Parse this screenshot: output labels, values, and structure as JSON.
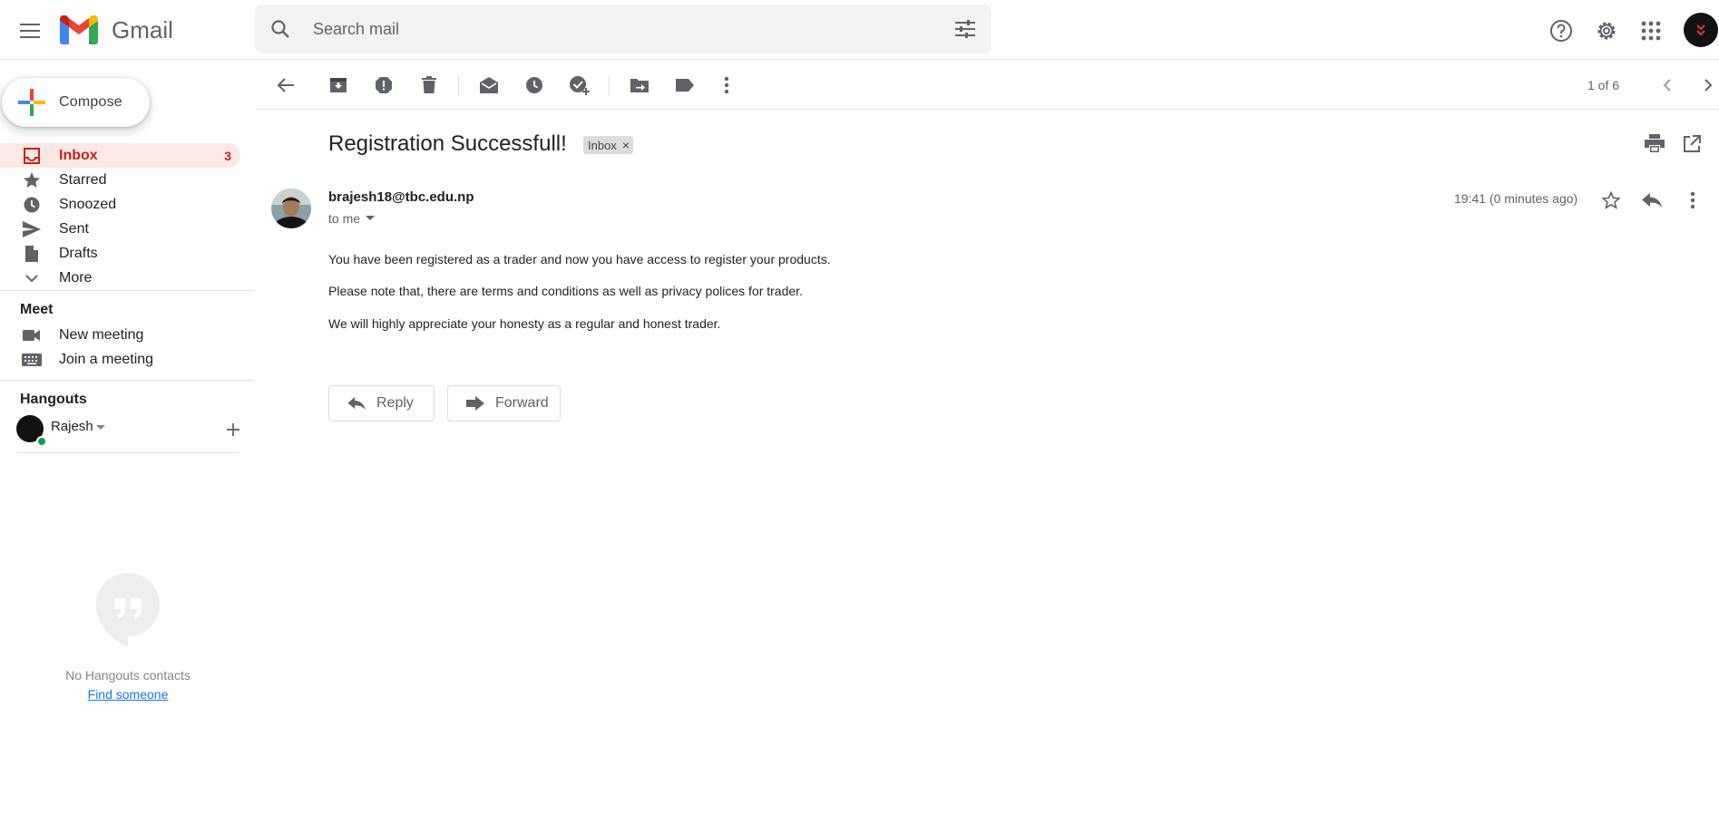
{
  "header": {
    "app_name": "Gmail",
    "search_placeholder": "Search mail",
    "icons": [
      "main-menu-icon",
      "gmail-logo",
      "search-icon",
      "search-options-icon",
      "help-icon",
      "settings-icon",
      "apps-icon",
      "account-avatar"
    ]
  },
  "sidebar": {
    "compose_label": "Compose",
    "items": [
      {
        "label": "Inbox",
        "count": "3",
        "icon": "inbox-icon",
        "active": true
      },
      {
        "label": "Starred",
        "icon": "star-icon"
      },
      {
        "label": "Snoozed",
        "icon": "clock-icon"
      },
      {
        "label": "Sent",
        "icon": "send-icon"
      },
      {
        "label": "Drafts",
        "icon": "draft-icon"
      },
      {
        "label": "More",
        "icon": "chevron-down-icon"
      }
    ],
    "meet": {
      "title": "Meet",
      "items": [
        {
          "label": "New meeting",
          "icon": "video-icon"
        },
        {
          "label": "Join a meeting",
          "icon": "keyboard-icon"
        }
      ]
    },
    "hangouts": {
      "title": "Hangouts",
      "user": "Rajesh",
      "empty_text": "No Hangouts contacts",
      "find_link": "Find someone"
    }
  },
  "toolbar": {
    "pager": "1 of 6",
    "buttons": [
      "back-arrow-icon",
      "archive-icon",
      "report-spam-icon",
      "delete-icon",
      "mark-unread-icon",
      "snooze-icon",
      "add-to-tasks-icon",
      "move-to-icon",
      "label-icon",
      "more-vert-icon",
      "newer-icon",
      "older-icon"
    ]
  },
  "message": {
    "subject": "Registration Successfull!",
    "label_chip": "Inbox",
    "label_chip_close": "×",
    "sender": "brajesh18@tbc.edu.np",
    "recipient": "to me",
    "timestamp": "19:41 (0 minutes ago)",
    "body": [
      "You have been registered as a trader and now you have access to register your products.",
      "Please note that, there are terms and conditions as well as privacy polices for trader.",
      "We will highly appreciate your honesty as a regular and honest trader."
    ],
    "reply_label": "Reply",
    "forward_label": "Forward"
  },
  "colors": {
    "active_bg": "#fce8e6",
    "active_text": "#c5221f",
    "search_bg": "#f1f3f4",
    "link": "#1a73e8"
  }
}
